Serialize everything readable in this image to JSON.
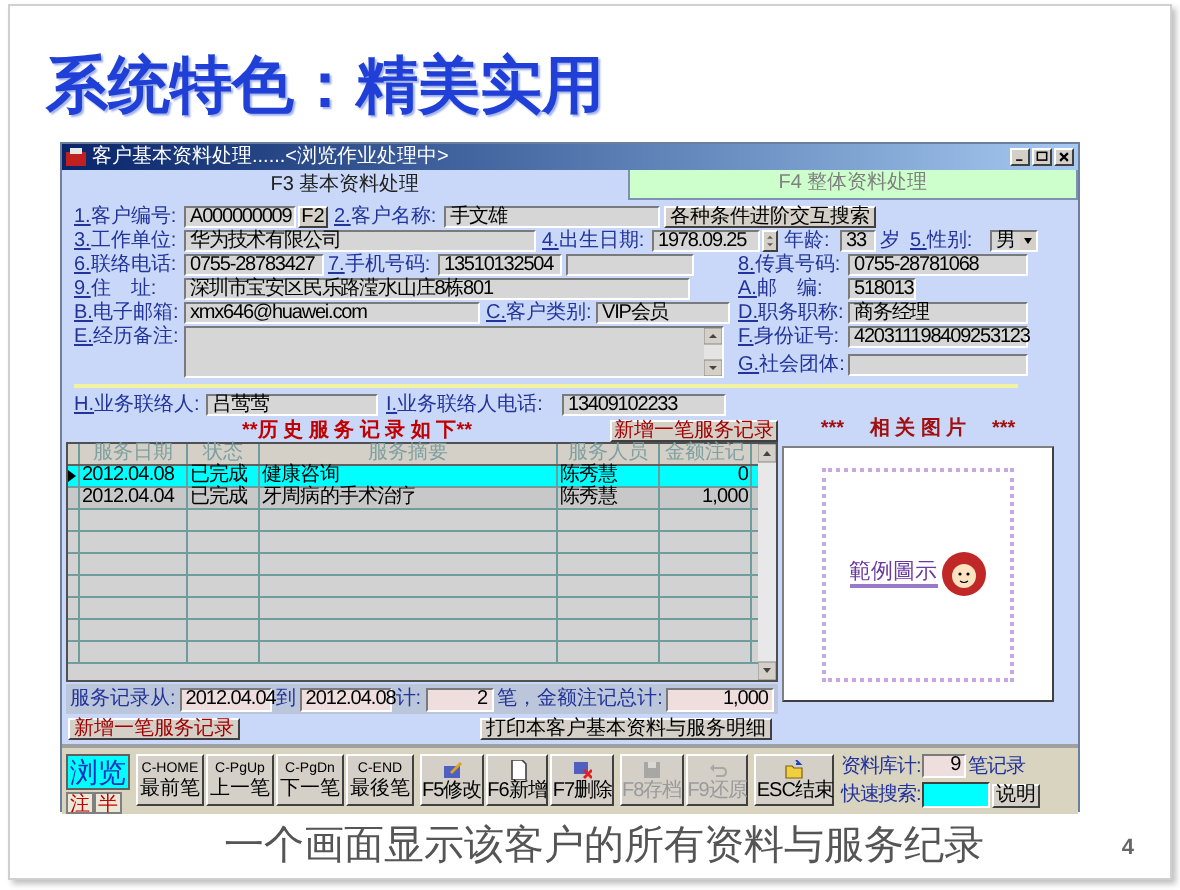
{
  "slide": {
    "title": "系统特色：精美实用",
    "caption": "一个画面显示该客户的所有资料与服务纪录",
    "page_number": "4"
  },
  "window": {
    "title": "客户基本资料处理......<浏览作业处理中>"
  },
  "tabs": [
    {
      "label": "F3 基本资料处理",
      "selected": true
    },
    {
      "label": "F4 整体资料处理",
      "selected": false
    }
  ],
  "form_rows": [
    [
      {
        "kind": "field",
        "key": "1.",
        "label": "客户编号:",
        "value": "A000000009"
      },
      {
        "kind": "button",
        "label": "F2"
      },
      {
        "kind": "field",
        "key": "2.",
        "label": "客户名称:",
        "value": "手文雄"
      },
      {
        "kind": "button",
        "label": "各种条件进阶交互搜索"
      }
    ],
    [
      {
        "kind": "field",
        "key": "3.",
        "label": "工作单位:",
        "value": "华为技术有限公司"
      },
      {
        "kind": "field",
        "key": "4.",
        "label": "出生日期:",
        "value": "1978.09.25"
      },
      {
        "kind": "spinner"
      },
      {
        "kind": "field",
        "label": "年龄:",
        "value": "33"
      },
      {
        "kind": "text",
        "label": "岁"
      },
      {
        "kind": "select",
        "key": "5.",
        "label": "性别:",
        "value": "男"
      }
    ],
    [
      {
        "kind": "field",
        "key": "6.",
        "label": "联络电话:",
        "value": "0755-28783427"
      },
      {
        "kind": "field",
        "key": "7.",
        "label": "手机号码:",
        "value": "13510132504"
      },
      {
        "kind": "field"
      },
      {
        "kind": "field",
        "key": "8.",
        "label": "传真号码:",
        "value": "0755-28781068"
      }
    ],
    [
      {
        "kind": "field",
        "key": "9.",
        "label": "住　址:",
        "value": "深圳市宝安区民乐路滢水山庄8栋801"
      },
      {
        "kind": "field",
        "key": "A.",
        "label": "邮　编:",
        "value": "518013"
      }
    ],
    [
      {
        "kind": "field",
        "key": "B.",
        "label": "电子邮箱:",
        "value": "xmx646@huawei.com"
      },
      {
        "kind": "field",
        "key": "C.",
        "label": "客户类别:",
        "value": "VIP会员"
      },
      {
        "kind": "field",
        "key": "D.",
        "label": "职务职称:",
        "value": "商务经理"
      }
    ],
    [
      {
        "kind": "textarea",
        "key": "E.",
        "label": "经历备注:"
      },
      {
        "kind": "stack",
        "items": [
          {
            "kind": "field",
            "key": "F.",
            "label": "身份证号:",
            "value": "420311198409253123"
          },
          {
            "kind": "field",
            "key": "G.",
            "label": "社会团体:"
          }
        ]
      }
    ],
    [
      {
        "kind": "field",
        "key": "H.",
        "label": "业务联络人:",
        "value": "吕莺莺"
      },
      {
        "kind": "field",
        "key": "I.",
        "label": "业务联络人电话:",
        "value": "13409102233"
      }
    ]
  ],
  "history": {
    "heading": "**历 史 服 务 记 录 如 下**",
    "add_button": "新增一笔服务记录",
    "columns": [
      "服务日期",
      "状态",
      "服务摘要",
      "服务人员",
      "金额注记"
    ],
    "rows": [
      {
        "date": "2012.04.08",
        "status": "已完成",
        "summary": "健康咨询",
        "staff": "陈秀慧",
        "amount": "0",
        "selected": true
      },
      {
        "date": "2012.04.04",
        "status": "已完成",
        "summary": "牙周病的手术治疗",
        "staff": "陈秀慧",
        "amount": "1,000",
        "selected": false
      }
    ],
    "summary": {
      "from_label": "服务记录从:",
      "from": "2012.04.04",
      "to_label": "到",
      "to": "2012.04.08",
      "count_label": "计:",
      "count": "2",
      "total_label": "笔，金额注记总计:",
      "total": "1,000"
    }
  },
  "pictures": {
    "heading": "***　 相 关 图 片 　***",
    "caption": "範例圖示"
  },
  "actions": [
    {
      "label": "新增一笔服务记录"
    },
    {
      "label": "打印本客户基本资料与服务明细"
    }
  ],
  "toolbar": {
    "mode": "浏览",
    "nav": [
      {
        "key": "C-HOME",
        "label": "最前笔"
      },
      {
        "key": "C-PgUp",
        "label": "上一笔"
      },
      {
        "key": "C-PgDn",
        "label": "下一笔"
      },
      {
        "key": "C-END",
        "label": "最後笔"
      }
    ],
    "tools": [
      {
        "kind": "edit",
        "label": "F5修改",
        "disabled": false
      },
      {
        "kind": "new",
        "label": "F6新增",
        "disabled": false
      },
      {
        "kind": "delete",
        "label": "F7删除",
        "disabled": false
      },
      {
        "kind": "save",
        "label": "F8存档",
        "disabled": true
      },
      {
        "kind": "undo",
        "label": "F9还原",
        "disabled": true
      },
      {
        "kind": "exit",
        "label": "ESC结束",
        "disabled": false
      }
    ],
    "record_label": "资料库计:",
    "record_count": "9",
    "record_unit": "笔记录",
    "search_label": "快速搜索:",
    "help_button": "说明",
    "bottom_tabs": [
      "注",
      "半"
    ]
  }
}
